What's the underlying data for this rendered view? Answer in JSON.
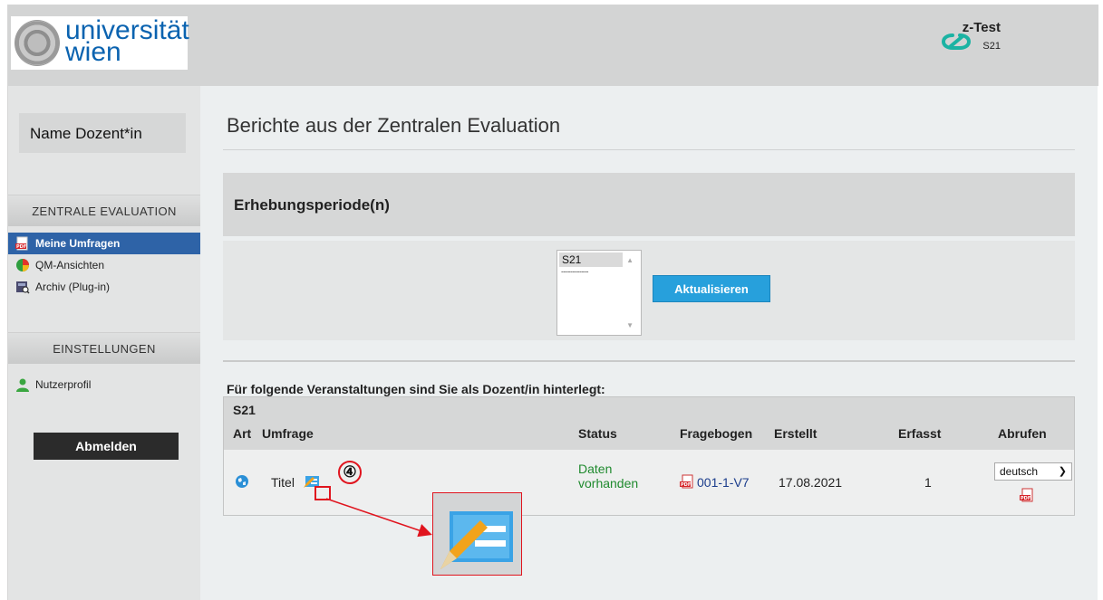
{
  "header": {
    "logo_line1": "universität",
    "logo_line2": "wien",
    "user_name": "z-Test",
    "user_semester": "S21",
    "brand_icon": "link-logo-icon"
  },
  "sidebar": {
    "user_box": "Name Dozent*in",
    "section_eval": "ZENTRALE EVALUATION",
    "items": [
      {
        "label": "Meine Umfragen",
        "icon": "pdf-icon",
        "active": true
      },
      {
        "label": "QM-Ansichten",
        "icon": "pie-chart-icon",
        "active": false
      },
      {
        "label": "Archiv (Plug-in)",
        "icon": "archive-search-icon",
        "active": false
      }
    ],
    "section_settings": "EINSTELLUNGEN",
    "settings_items": [
      {
        "label": "Nutzerprofil",
        "icon": "user-icon"
      }
    ],
    "logout_label": "Abmelden"
  },
  "main": {
    "title": "Berichte aus der Zentralen Evaluation",
    "period": {
      "heading": "Erhebungsperiode(n)",
      "options": [
        "S21",
        "------------"
      ],
      "selected": "S21",
      "button": "Aktualisieren"
    },
    "intro": "Für folgende Veranstaltungen sind Sie als Dozent/in hinterlegt:",
    "table": {
      "semester": "S21",
      "columns": [
        "Art",
        "Umfrage",
        "Status",
        "Fragebogen",
        "Erstellt",
        "Erfasst",
        "Abrufen"
      ],
      "rows": [
        {
          "art_icon": "globe-icon",
          "umfrage": "Titel",
          "edit_icon": "edit-pencil-icon",
          "status_line1": "Daten",
          "status_line2": "vorhanden",
          "fragebogen": "001-1-V7",
          "erstellt": "17.08.2021",
          "erfasst": "1",
          "language": "deutsch"
        }
      ]
    }
  },
  "annotation": {
    "step_number": "④",
    "color": "#e0141e"
  }
}
